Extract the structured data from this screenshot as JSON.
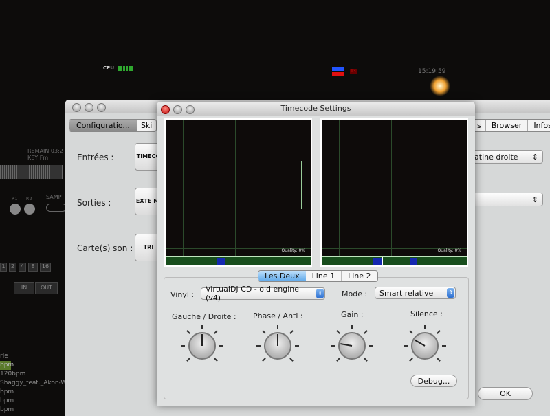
{
  "topbar": {
    "cpu_label": "CPU",
    "clock": "15:19:59",
    "badge": "13"
  },
  "dj_app": {
    "remain": "REMAIN 03:2",
    "key": "KEY Fm",
    "pitch_labels": [
      "P.1",
      "P.2"
    ],
    "sampler": "SAMP",
    "loop_buttons": [
      "1",
      "2",
      "4",
      "8",
      "16"
    ],
    "in_label": "IN",
    "out_label": "OUT",
    "list": [
      "rle",
      "bpm",
      "120bpm",
      "Shaggy_feat._Akon-Wh",
      "bpm",
      "bpm",
      "bpm"
    ]
  },
  "config_window": {
    "tabs": [
      "Configuratio...",
      "Ski",
      "s",
      "Browser",
      "Infos"
    ],
    "rows": [
      {
        "label": "Entrées :",
        "button": "TIMECO"
      },
      {
        "label": "Sorties :",
        "button": "EXTE MI"
      },
      {
        "label": "Carte(s) son :",
        "button": "TRI"
      }
    ],
    "dropdown1": "latine droite",
    "dropdown2": "",
    "ok_label": "OK"
  },
  "timecode_window": {
    "title": "Timecode Settings",
    "scopes": [
      {
        "quality": "Quality: 0%"
      },
      {
        "quality": "Quality: 0%"
      }
    ],
    "tabs": [
      "Les Deux",
      "Line 1",
      "Line 2"
    ],
    "active_tab": "Les Deux",
    "vinyl_label": "Vinyl :",
    "vinyl_value": "VirtualDJ CD - old engine (v4)",
    "mode_label": "Mode :",
    "mode_value": "Smart relative",
    "knobs": [
      {
        "label": "Gauche / Droite :",
        "angle_deg": 0
      },
      {
        "label": "Phase / Anti :",
        "angle_deg": 0
      },
      {
        "label": "Gain :",
        "angle_deg": -80
      },
      {
        "label": "Silence :",
        "angle_deg": -60
      }
    ],
    "debug_label": "Debug..."
  }
}
